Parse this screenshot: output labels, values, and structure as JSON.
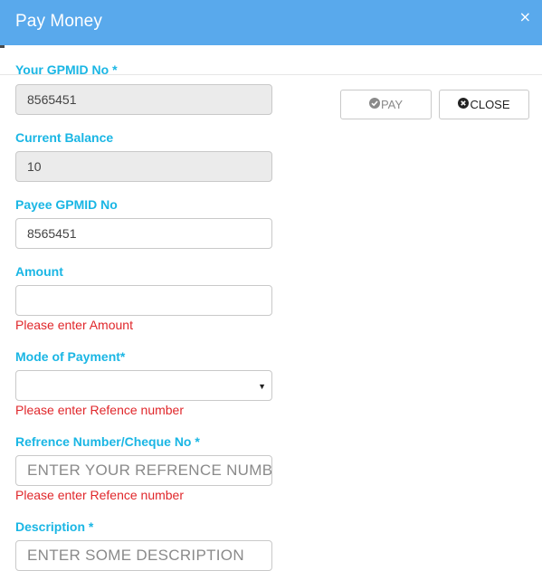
{
  "header": {
    "title": "Pay Money",
    "close_icon": "×"
  },
  "fields": {
    "gpmid": {
      "label": "Your GPMID No *",
      "value": "8565451"
    },
    "balance": {
      "label": "Current Balance",
      "value": "10"
    },
    "payee": {
      "label": "Payee GPMID No",
      "value": "8565451"
    },
    "amount": {
      "label": "Amount",
      "value": "",
      "error": "Please enter Amount"
    },
    "mode": {
      "label": "Mode of Payment*",
      "value": "",
      "error": "Please enter Refence number"
    },
    "reference": {
      "label": "Refrence Number/Cheque No *",
      "placeholder": "ENTER YOUR REFRENCE NUMBER",
      "error": "Please enter Refence number"
    },
    "description": {
      "label": "Description *",
      "placeholder": "ENTER SOME DESCRIPTION"
    }
  },
  "buttons": {
    "pay": {
      "label": "PAY",
      "icon": "check-circle-icon"
    },
    "close": {
      "label": "CLOSE",
      "icon": "times-circle-icon"
    }
  },
  "colors": {
    "header_bg": "#59a9ec",
    "label": "#1ab6e4",
    "error": "#e0272b"
  }
}
